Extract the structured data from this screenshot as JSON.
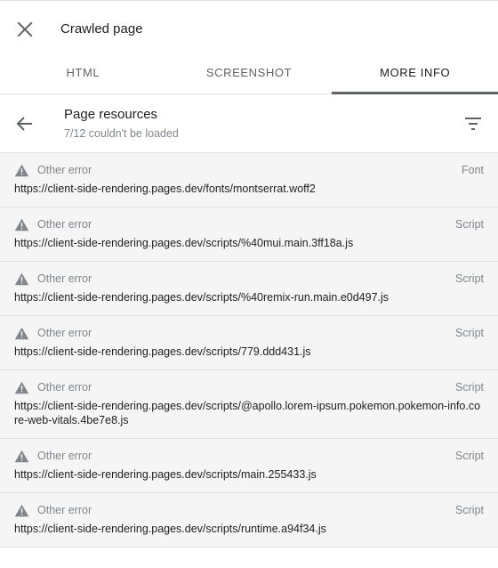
{
  "topbar": {
    "title": "Crawled page",
    "close_icon": "close-icon"
  },
  "tabs": [
    {
      "label": "HTML",
      "active": false
    },
    {
      "label": "SCREENSHOT",
      "active": false
    },
    {
      "label": "MORE INFO",
      "active": true
    }
  ],
  "resources": {
    "title": "Page resources",
    "subtitle": "7/12 couldn't be loaded",
    "back_icon": "arrow-back-icon",
    "filter_icon": "filter-icon"
  },
  "items": [
    {
      "error": "Other error",
      "type": "Font",
      "url": "https://client-side-rendering.pages.dev/fonts/montserrat.woff2"
    },
    {
      "error": "Other error",
      "type": "Script",
      "url": "https://client-side-rendering.pages.dev/scripts/%40mui.main.3ff18a.js"
    },
    {
      "error": "Other error",
      "type": "Script",
      "url": "https://client-side-rendering.pages.dev/scripts/%40remix-run.main.e0d497.js"
    },
    {
      "error": "Other error",
      "type": "Script",
      "url": "https://client-side-rendering.pages.dev/scripts/779.ddd431.js"
    },
    {
      "error": "Other error",
      "type": "Script",
      "url": "https://client-side-rendering.pages.dev/scripts/@apollo.lorem-ipsum.pokemon.pokemon-info.core-web-vitals.4be7e8.js"
    },
    {
      "error": "Other error",
      "type": "Script",
      "url": "https://client-side-rendering.pages.dev/scripts/main.255433.js"
    },
    {
      "error": "Other error",
      "type": "Script",
      "url": "https://client-side-rendering.pages.dev/scripts/runtime.a94f34.js"
    }
  ],
  "colors": {
    "text_primary": "#202124",
    "text_secondary": "#80868b",
    "list_bg": "#f5f5f5",
    "divider": "#e0e0e0",
    "active_tab_indicator": "#5f6368"
  }
}
